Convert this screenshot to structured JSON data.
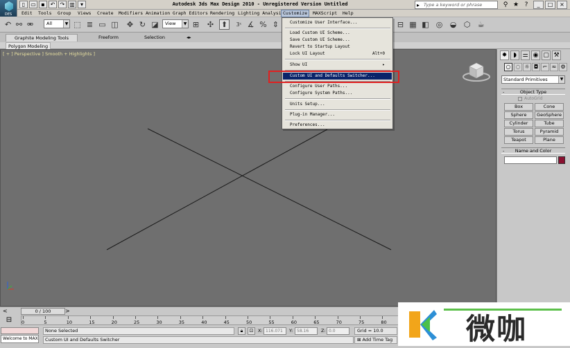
{
  "title_bar": {
    "title": "Autodesk 3ds Max Design 2010   - Unregistered Version   Untitled",
    "search_placeholder": "Type a keyword or phrase",
    "logo_caption": "DES"
  },
  "menubar": {
    "items": [
      "Edit",
      "Tools",
      "Group",
      "Views",
      "Create",
      "Modifiers",
      "Animation",
      "Graph Editors",
      "Rendering",
      "Lighting Analysis",
      "Customize",
      "MAXScript",
      "Help"
    ],
    "active": "Customize"
  },
  "toolbar": {
    "selection_filter": "All",
    "reference_coord": "View",
    "snap_label": "3"
  },
  "ribbon": {
    "tabs": [
      "Graphite Modeling Tools",
      "Freeform",
      "Selection"
    ],
    "subtab": "Polygon Modeling"
  },
  "viewport": {
    "label": "[ + ] Perspective ] Smooth + Highlights ]"
  },
  "customize_menu": {
    "items": [
      {
        "label": "Customize User Interface...",
        "shortcut": ""
      },
      {
        "label": "Load Custom UI Scheme...",
        "shortcut": ""
      },
      {
        "label": "Save Custom UI Scheme...",
        "shortcut": ""
      },
      {
        "label": "Revert to Startup Layout",
        "shortcut": ""
      },
      {
        "label": "Lock UI Layout",
        "shortcut": "Alt+0"
      },
      {
        "label": "Show UI",
        "shortcut": "▸"
      },
      {
        "label": "Custom UI and Defaults Switcher...",
        "shortcut": ""
      },
      {
        "label": "Configure User Paths...",
        "shortcut": ""
      },
      {
        "label": "Configure System Paths...",
        "shortcut": ""
      },
      {
        "label": "Units Setup...",
        "shortcut": ""
      },
      {
        "label": "Plug-in Manager...",
        "shortcut": ""
      },
      {
        "label": "Preferences...",
        "shortcut": ""
      }
    ],
    "highlighted": "Custom UI and Defaults Switcher..."
  },
  "command_panel": {
    "primitive_type": "Standard Primitives",
    "object_type_header": "Object Type",
    "autogrid_label": "AutoGrid",
    "buttons": [
      "Box",
      "Cone",
      "Sphere",
      "GeoSphere",
      "Cylinder",
      "Tube",
      "Torus",
      "Pyramid",
      "Teapot",
      "Plane"
    ],
    "name_color_header": "Name and Color",
    "swatch_color": "#8a1030"
  },
  "timeline": {
    "slider": "0 / 100",
    "ticks": [
      "0",
      "5",
      "10",
      "15",
      "20",
      "25",
      "30",
      "35",
      "40",
      "45",
      "50",
      "55",
      "60",
      "65",
      "70",
      "75",
      "80"
    ]
  },
  "statusbar": {
    "maxscript": "Welcome to MAX!",
    "selection": "None Selected",
    "prompt": "Custom UI and Defaults Switcher",
    "x_label": "X:",
    "x_value": "116.071",
    "y_label": "Y:",
    "y_value": "58.16",
    "z_label": "Z:",
    "z_value": "0.0",
    "grid": "Grid = 10.0",
    "add_time_tag": "Add Time Tag"
  },
  "watermark": {
    "text": "微咖"
  },
  "colors": {
    "menu_highlight": "#0a246a",
    "annotation_box": "#e02020",
    "viewport_bg": "#6f6f6f"
  }
}
